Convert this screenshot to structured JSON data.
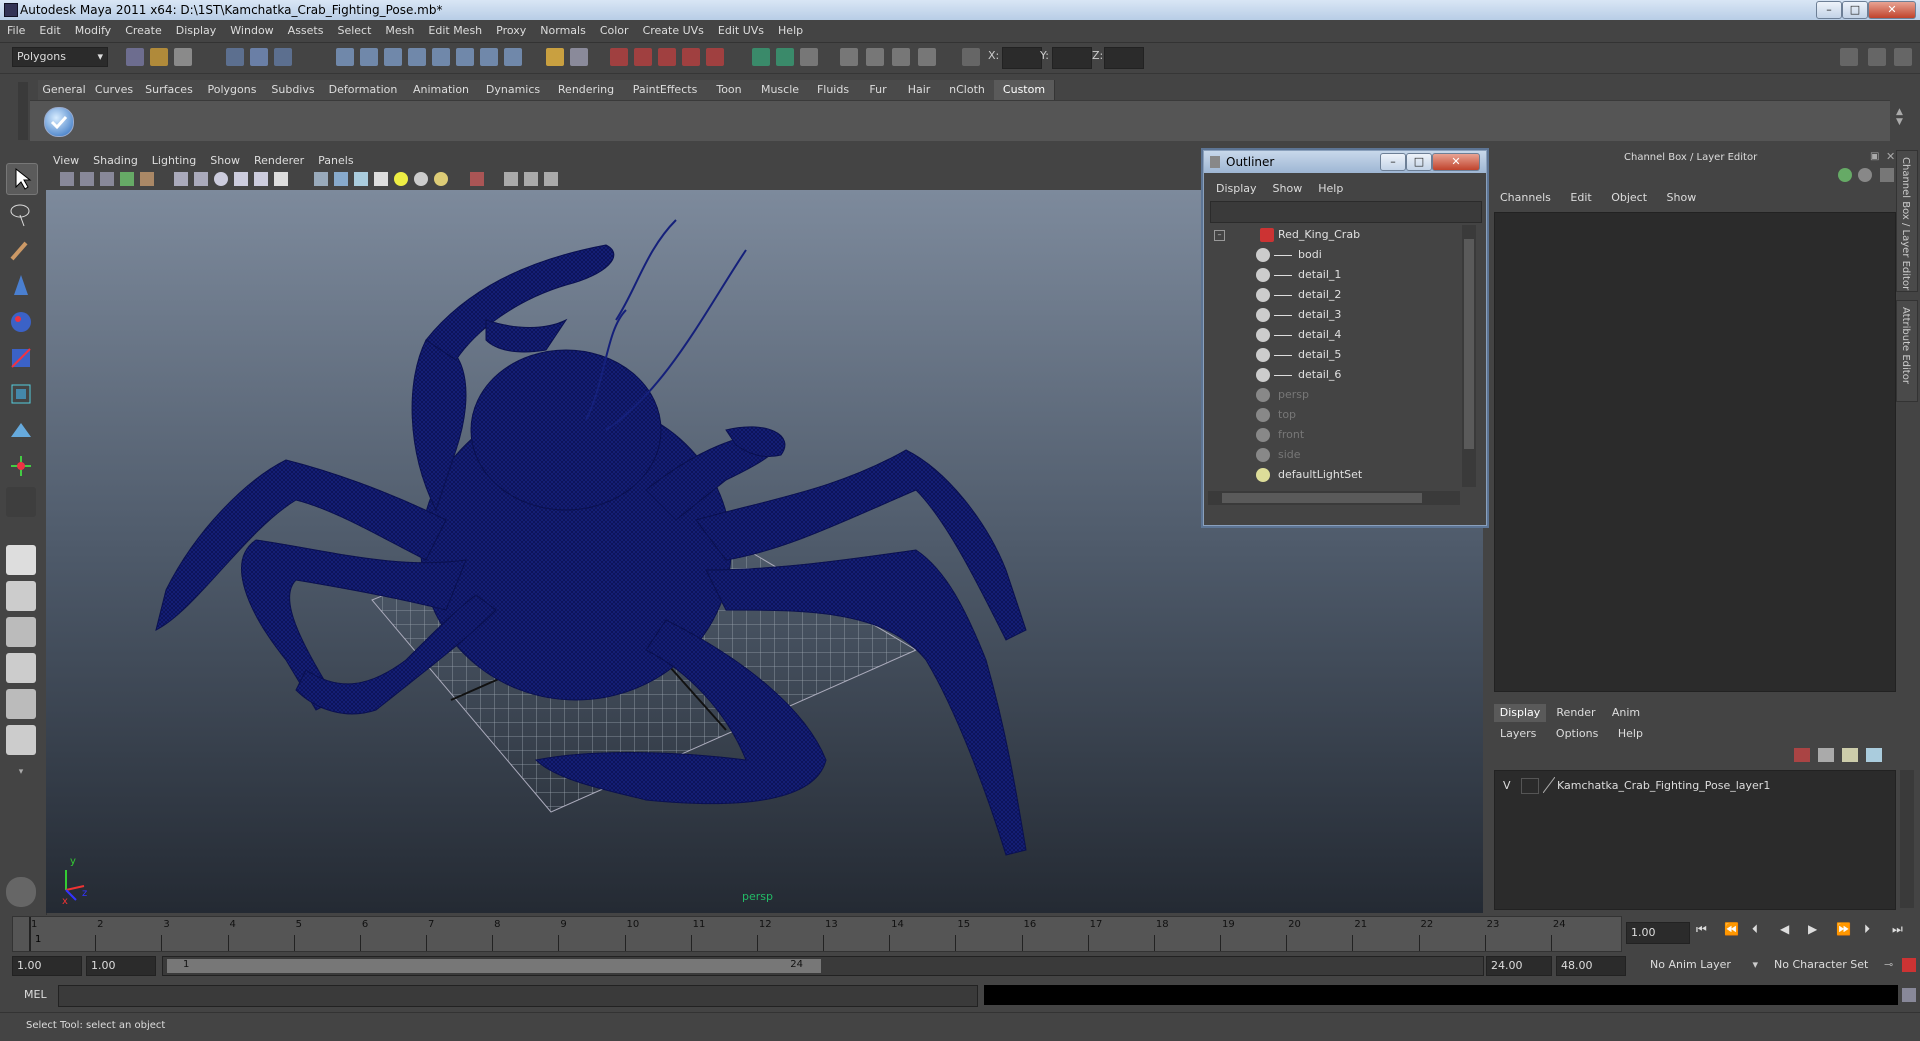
{
  "window": {
    "title": "Autodesk Maya 2011 x64: D:\\1ST\\Kamchatka_Crab_Fighting_Pose.mb*"
  },
  "menubar": [
    "File",
    "Edit",
    "Modify",
    "Create",
    "Display",
    "Window",
    "Assets",
    "Select",
    "Mesh",
    "Edit Mesh",
    "Proxy",
    "Normals",
    "Color",
    "Create UVs",
    "Edit UVs",
    "Help"
  ],
  "statusline": {
    "menuset": "Polygons",
    "x_label": "X:",
    "y_label": "Y:",
    "z_label": "Z:"
  },
  "shelf_tabs": [
    "General",
    "Curves",
    "Surfaces",
    "Polygons",
    "Subdivs",
    "Deformation",
    "Animation",
    "Dynamics",
    "Rendering",
    "PaintEffects",
    "Toon",
    "Muscle",
    "Fluids",
    "Fur",
    "Hair",
    "nCloth",
    "Custom"
  ],
  "shelf_active": "Custom",
  "viewport": {
    "menus": [
      "View",
      "Shading",
      "Lighting",
      "Show",
      "Renderer",
      "Panels"
    ],
    "camera_label": "persp",
    "axis_x": "x",
    "axis_y": "y",
    "axis_z": "z"
  },
  "outliner": {
    "title": "Outliner",
    "menus": [
      "Display",
      "Show",
      "Help"
    ],
    "items": [
      {
        "label": "Red_King_Crab",
        "indent": 0,
        "dim": false
      },
      {
        "label": "bodi",
        "indent": 1,
        "dim": false
      },
      {
        "label": "detail_1",
        "indent": 1,
        "dim": false
      },
      {
        "label": "detail_2",
        "indent": 1,
        "dim": false
      },
      {
        "label": "detail_3",
        "indent": 1,
        "dim": false
      },
      {
        "label": "detail_4",
        "indent": 1,
        "dim": false
      },
      {
        "label": "detail_5",
        "indent": 1,
        "dim": false
      },
      {
        "label": "detail_6",
        "indent": 1,
        "dim": false
      },
      {
        "label": "persp",
        "indent": 0,
        "dim": true
      },
      {
        "label": "top",
        "indent": 0,
        "dim": true
      },
      {
        "label": "front",
        "indent": 0,
        "dim": true
      },
      {
        "label": "side",
        "indent": 0,
        "dim": true
      },
      {
        "label": "defaultLightSet",
        "indent": 0,
        "dim": false
      }
    ]
  },
  "channelbox": {
    "header": "Channel Box / Layer Editor",
    "menus": [
      "Channels",
      "Edit",
      "Object",
      "Show"
    ],
    "side_tabs": [
      "Channel Box / Layer Editor",
      "Attribute Editor"
    ]
  },
  "layereditor": {
    "tabs": [
      "Display",
      "Render",
      "Anim"
    ],
    "active_tab": "Display",
    "menus": [
      "Layers",
      "Options",
      "Help"
    ],
    "layer": {
      "visible": "V",
      "name": "Kamchatka_Crab_Fighting_Pose_layer1"
    }
  },
  "timeline": {
    "ticks": [
      "1",
      "2",
      "3",
      "4",
      "5",
      "6",
      "7",
      "8",
      "9",
      "10",
      "11",
      "12",
      "13",
      "14",
      "15",
      "16",
      "17",
      "18",
      "19",
      "20",
      "21",
      "22",
      "23",
      "24"
    ],
    "current_frame": "1",
    "current_time": "1.00"
  },
  "range": {
    "start": "1.00",
    "start2": "1.00",
    "slider_start": "1",
    "slider_end": "24",
    "end": "24.00",
    "end2": "48.00",
    "anim_layer": "No Anim Layer",
    "char_set": "No Character Set"
  },
  "cmd": {
    "label": "MEL"
  },
  "help": {
    "text": "Select Tool: select an object"
  },
  "colors": {
    "wireframe": "#0f1a6e",
    "ui_bg": "#444444",
    "active_tab": "#5a5a5a"
  }
}
